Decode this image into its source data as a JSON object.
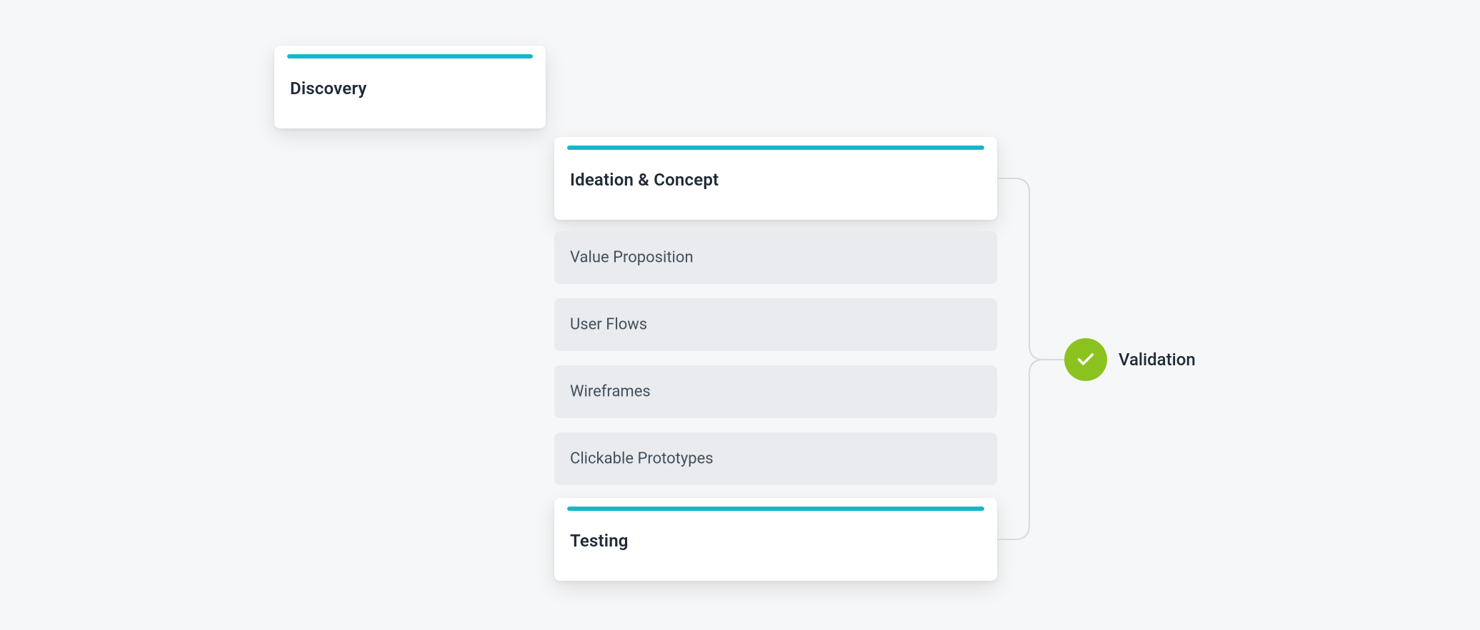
{
  "colors": {
    "accent_teal": "#18b6c8",
    "validation_green": "#8bc220",
    "card_bg": "#ffffff",
    "task_bg": "#e9ebee",
    "page_bg": "#f6f7f8",
    "text_primary": "#1f2a37",
    "text_secondary": "#42505c",
    "bracket": "#d6dadf"
  },
  "phases": {
    "discovery": {
      "label": "Discovery"
    },
    "ideation": {
      "label": "Ideation & Concept"
    },
    "testing": {
      "label": "Testing"
    }
  },
  "tasks": [
    {
      "label": "Value Proposition"
    },
    {
      "label": "User Flows"
    },
    {
      "label": "Wireframes"
    },
    {
      "label": "Clickable Prototypes"
    }
  ],
  "validation": {
    "label": "Validation",
    "icon": "check-icon"
  }
}
